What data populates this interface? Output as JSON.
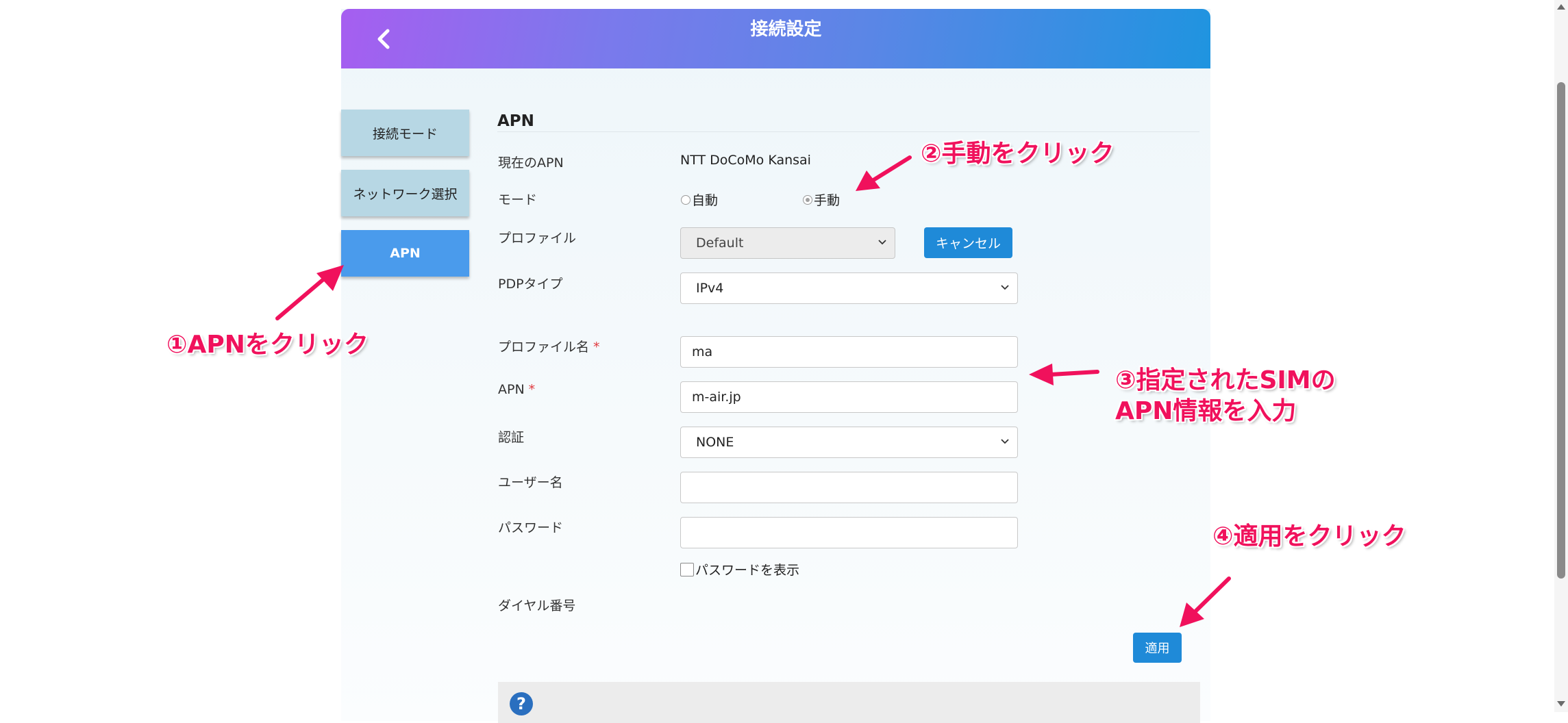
{
  "header": {
    "title": "接続設定"
  },
  "sidebar": {
    "items": [
      {
        "label": "接続モード"
      },
      {
        "label": "ネットワーク選択"
      },
      {
        "label": "APN"
      }
    ]
  },
  "apn": {
    "section_title": "APN",
    "current_apn_label": "現在のAPN",
    "current_apn_value": "NTT DoCoMo Kansai",
    "mode_label": "モード",
    "mode_options": {
      "auto": "自動",
      "manual": "手動"
    },
    "mode_selected": "手動",
    "profile_label": "プロファイル",
    "profile_value": "Default",
    "cancel_label": "キャンセル",
    "pdp_label": "PDPタイプ",
    "pdp_value": "IPv4",
    "profile_name_label": "プロファイル名",
    "profile_name_value": "ma",
    "apn_label": "APN",
    "apn_value": "m-air.jp",
    "required_mark": "*",
    "auth_label": "認証",
    "auth_value": "NONE",
    "username_label": "ユーザー名",
    "username_value": "",
    "password_label": "パスワード",
    "password_value": "",
    "show_password_label": "パスワードを表示",
    "dial_label": "ダイヤル番号",
    "apply_label": "適用"
  },
  "annotations": {
    "step1": "①APNをクリック",
    "step2": "②手動をクリック",
    "step3_line1": "③指定されたSIMの",
    "step3_line2": "APN情報を入力",
    "step4": "④適用をクリック",
    "color": "#f0115c"
  },
  "colors": {
    "header_gradient_start": "#a65ef0",
    "header_gradient_end": "#1f94e0",
    "sidebar_inactive": "#b7d7e4",
    "sidebar_active": "#4a9bec",
    "button_primary": "#1f8ad8"
  },
  "icons": {
    "back": "chevron-left-icon",
    "help": "question-circle-icon"
  }
}
